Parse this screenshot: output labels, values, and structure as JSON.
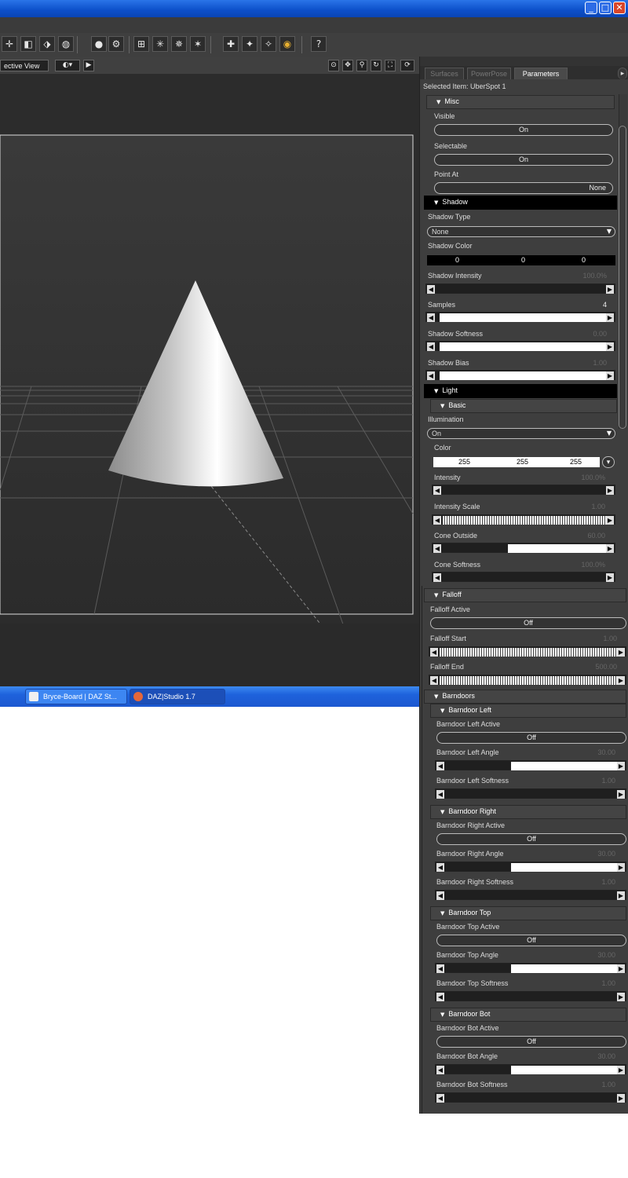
{
  "window": {
    "minimize_glyph": "_",
    "maximize_glyph": "□",
    "close_glyph": "✕"
  },
  "viewport": {
    "view_label": "ective View",
    "view_dropdown_glyph": "▼"
  },
  "taskbar": {
    "items": [
      {
        "label": "Bryce-Board | DAZ St..."
      },
      {
        "label": "DAZ|Studio 1.7"
      }
    ]
  },
  "panel": {
    "tabs": [
      "Surfaces",
      "PowerPose",
      "Parameters"
    ],
    "active_tab": "Parameters",
    "selected_item": "Selected Item: UberSpot 1",
    "misc": {
      "header": "Misc",
      "visible_label": "Visible",
      "visible_value": "On",
      "selectable_label": "Selectable",
      "selectable_value": "On",
      "point_at_label": "Point At",
      "point_at_value": "None"
    },
    "shadow": {
      "header": "Shadow",
      "type_label": "Shadow Type",
      "type_value": "None",
      "color_label": "Shadow Color",
      "color_r": "0",
      "color_g": "0",
      "color_b": "0",
      "intensity_label": "Shadow Intensity",
      "intensity_value": "100.0%",
      "intensity_fill": 0,
      "samples_label": "Samples",
      "samples_value": "4",
      "samples_fill": 0.98,
      "softness_label": "Shadow Softness",
      "softness_value": "0.00",
      "softness_fill": 0.98,
      "bias_label": "Shadow Bias",
      "bias_value": "1.00",
      "bias_fill": 0.98
    },
    "light": {
      "header": "Light",
      "basic_header": "Basic",
      "illumination_label": "Illumination",
      "illumination_value": "On",
      "color_label": "Color",
      "color_r": "255",
      "color_g": "255",
      "color_b": "255",
      "intensity_label": "Intensity",
      "intensity_value": "100.0%",
      "intensity_fill": 0,
      "intensity_scale_label": "Intensity Scale",
      "intensity_scale_value": "1.00",
      "intensity_scale_fill": 1,
      "cone_outside_label": "Cone Outside",
      "cone_outside_value": "60.00",
      "cone_outside_fill": 0.6,
      "cone_softness_label": "Cone Softness",
      "cone_softness_value": "100.0%",
      "cone_softness_fill": 0
    },
    "falloff": {
      "header": "Falloff",
      "active_label": "Falloff Active",
      "active_value": "Off",
      "start_label": "Falloff Start",
      "start_value": "1.00",
      "start_fill": 1,
      "end_label": "Falloff End",
      "end_value": "500.00",
      "end_fill": 1
    },
    "barndoors": {
      "header": "Barndoors",
      "sections": [
        {
          "header": "Barndoor Left",
          "active_label": "Barndoor Left Active",
          "active_value": "Off",
          "angle_label": "Barndoor Left Angle",
          "angle_value": "30.00",
          "angle_fill": 0.62,
          "softness_label": "Barndoor Left Softness",
          "softness_value": "1.00",
          "softness_fill": 0
        },
        {
          "header": "Barndoor Right",
          "active_label": "Barndoor Right Active",
          "active_value": "Off",
          "angle_label": "Barndoor Right Angle",
          "angle_value": "30.00",
          "angle_fill": 0.62,
          "softness_label": "Barndoor Right Softness",
          "softness_value": "1.00",
          "softness_fill": 0
        },
        {
          "header": "Barndoor Top",
          "active_label": "Barndoor Top Active",
          "active_value": "Off",
          "angle_label": "Barndoor Top Angle",
          "angle_value": "30.00",
          "angle_fill": 0.62,
          "softness_label": "Barndoor Top Softness",
          "softness_value": "1.00",
          "softness_fill": 0
        },
        {
          "header": "Barndoor Bot",
          "active_label": "Barndoor Bot Active",
          "active_value": "Off",
          "angle_label": "Barndoor Bot Angle",
          "angle_value": "30.00",
          "angle_fill": 0.62,
          "softness_label": "Barndoor Bot Softness",
          "softness_value": "1.00",
          "softness_fill": 0
        }
      ]
    }
  },
  "colors": {
    "title_bar": "#0c4fc9",
    "panel_bg": "#3e3e3e",
    "viewport_bg": "#2c2c2c",
    "close_button": "#d8462a"
  }
}
